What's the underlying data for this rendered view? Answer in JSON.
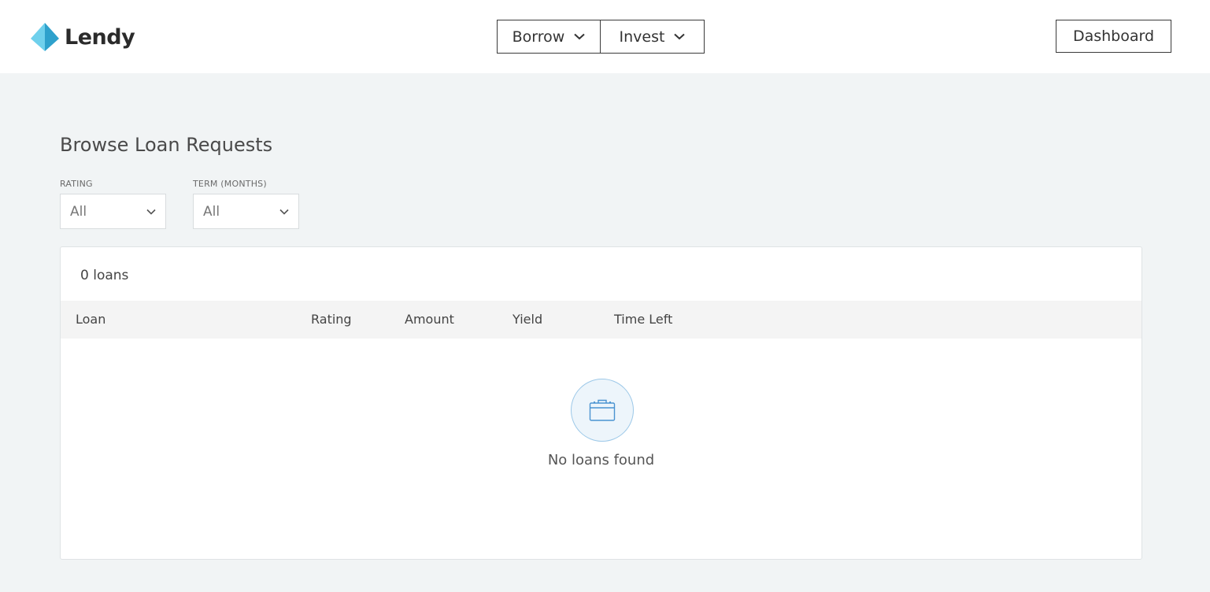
{
  "brand": {
    "name": "Lendy",
    "colors": {
      "logo_light": "#5bc8e8",
      "logo_dark": "#2fa2c9"
    }
  },
  "nav": {
    "borrow_label": "Borrow",
    "invest_label": "Invest",
    "dashboard_label": "Dashboard"
  },
  "page": {
    "title": "Browse Loan Requests"
  },
  "filters": {
    "rating": {
      "label": "RATING",
      "value": "All"
    },
    "term": {
      "label": "TERM (MONTHS)",
      "value": "All"
    }
  },
  "table": {
    "count_text": "0 loans",
    "columns": [
      "Loan",
      "Rating",
      "Amount",
      "Yield",
      "Time Left"
    ],
    "rows": [],
    "empty": {
      "icon": "briefcase-icon",
      "text": "No loans found"
    }
  }
}
